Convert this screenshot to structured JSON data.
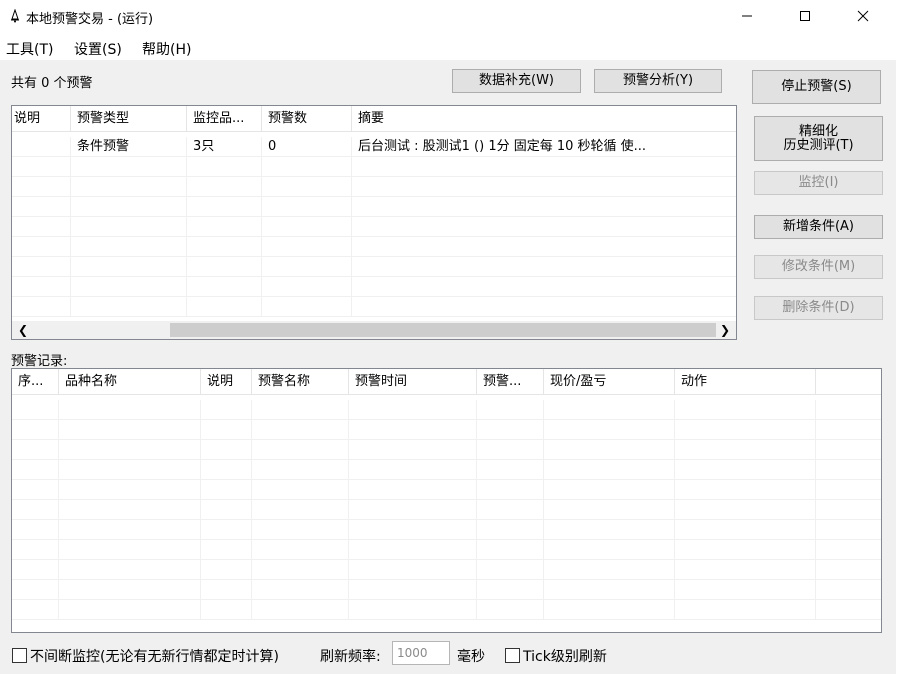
{
  "window": {
    "title": "本地预警交易 - (运行)"
  },
  "menu": [
    "工具(T)",
    "设置(S)",
    "帮助(H)"
  ],
  "summary": {
    "count_label": "共有 0 个预警"
  },
  "toolbar": {
    "data_fill": "数据补充(W)",
    "alert_analysis": "预警分析(Y)"
  },
  "side_buttons": {
    "stop_alert": "停止预警(S)",
    "fine_history_line1": "精细化",
    "fine_history_line2": "历史测评(T)",
    "monitor": "监控(I)",
    "add_condition": "新增条件(A)",
    "edit_condition": "修改条件(M)",
    "delete_condition": "删除条件(D)"
  },
  "alerts_table": {
    "columns": [
      "说明",
      "预警类型",
      "监控品...",
      "预警数",
      "摘要"
    ],
    "rows": [
      [
        "",
        "条件预警",
        "3只",
        "0",
        "后台测试 : 股测试1 () 1分 固定每 10 秒轮循 使..."
      ]
    ]
  },
  "records": {
    "label": "预警记录:",
    "columns": [
      "序...",
      "品种名称",
      "说明",
      "预警名称",
      "预警时间",
      "预警...",
      "现价/盈亏",
      "动作"
    ],
    "rows": []
  },
  "bottom": {
    "continuous_label": "不间断监控(无论有无新行情都定时计算)",
    "rate_label": "刷新频率:",
    "rate_value": "1000",
    "rate_unit": "毫秒",
    "tick_label": "Tick级别刷新"
  },
  "colors": {
    "client_bg": "#f0f0f0",
    "button_bg": "#e1e1e1",
    "disabled_text": "#8a8a8a"
  }
}
